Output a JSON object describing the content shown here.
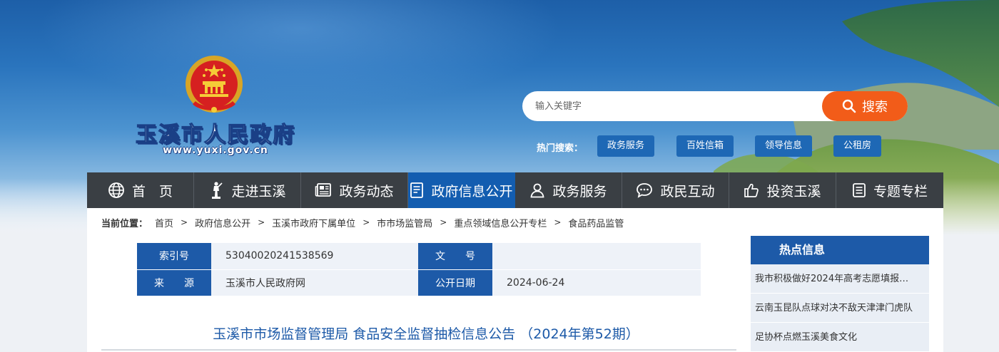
{
  "header": {
    "site_name": "玉溪市人民政府",
    "site_url": "www.yuxi.gov.cn"
  },
  "search": {
    "placeholder": "输入关键字",
    "button_label": "搜索",
    "hot_label": "热门搜索：",
    "hot_tags": [
      "政务服务",
      "百姓信箱",
      "领导信息",
      "公租房"
    ]
  },
  "nav": {
    "items": [
      {
        "label": "首　页",
        "icon": "globe-icon"
      },
      {
        "label": "走进玉溪",
        "icon": "statue-icon"
      },
      {
        "label": "政务动态",
        "icon": "newspaper-icon"
      },
      {
        "label": "政府信息公开",
        "icon": "document-icon"
      },
      {
        "label": "政务服务",
        "icon": "user-icon"
      },
      {
        "label": "政民互动",
        "icon": "chat-icon"
      },
      {
        "label": "投资玉溪",
        "icon": "thumbs-up-icon"
      },
      {
        "label": "专题专栏",
        "icon": "list-icon"
      }
    ],
    "active_index": 3
  },
  "breadcrumb": {
    "lead": "当前位置：",
    "items": [
      "首页",
      "政府信息公开",
      "玉溪市政府下属单位",
      "市市场监管局",
      "重点领域信息公开专栏",
      "食品药品监管"
    ]
  },
  "meta": {
    "index_label": "索引号",
    "index_value": "53040020241538569",
    "doc_no_label": "文　　号",
    "doc_no_value": "",
    "source_label": "来　　源",
    "source_value": "玉溪市人民政府网",
    "date_label": "公开日期",
    "date_value": "2024-06-24"
  },
  "article": {
    "title": "玉溪市市场监督管理局 食品安全监督抽检信息公告 （2024年第52期）"
  },
  "sidebar": {
    "title": "热点信息",
    "items": [
      "我市积极做好2024年高考志愿填报…",
      "云南玉昆队点球对决不敌天津津门虎队",
      "足协杯点燃玉溪美食文化"
    ]
  },
  "colors": {
    "nav_bg": "#3a3f44",
    "nav_active": "#135db0",
    "accent_blue": "#1d5aa8",
    "search_orange": "#f25c19"
  }
}
